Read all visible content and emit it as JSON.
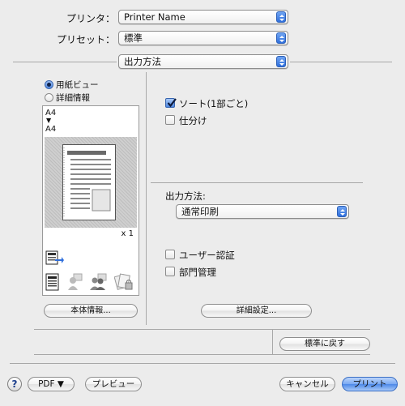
{
  "printer": {
    "label": "プリンタ：",
    "value": "Printer Name"
  },
  "preset": {
    "label": "プリセット：",
    "value": "標準"
  },
  "panel": {
    "value": "出力方法"
  },
  "preview_mode": {
    "paper_view": "用紙ビュー",
    "detail_info": "詳細情報",
    "selected": "paper_view"
  },
  "paper_preview": {
    "input_size": "A4",
    "arrow": "▼",
    "output_size": "A4",
    "copies": "x 1"
  },
  "options": {
    "sort_label": "ソート(1部ごと)",
    "sort_checked": true,
    "offset_label": "仕分け",
    "offset_checked": false
  },
  "output_method": {
    "label": "出力方法:",
    "value": "通常印刷"
  },
  "auth": {
    "user_auth_label": "ユーザー認証",
    "user_auth_checked": false,
    "dept_label": "部門管理",
    "dept_checked": false
  },
  "buttons": {
    "device_info": "本体情報...",
    "detail_settings": "詳細設定...",
    "reset": "標準に戻す",
    "help": "?",
    "pdf": "PDF ▼",
    "preview": "プレビュー",
    "cancel": "キャンセル",
    "print": "プリント"
  },
  "colors": {
    "accent": "#4c88e8",
    "background": "#ececec"
  },
  "icons": [
    "tray-icon",
    "document-icon",
    "user-icon",
    "users-icon",
    "lock-document-icon"
  ]
}
